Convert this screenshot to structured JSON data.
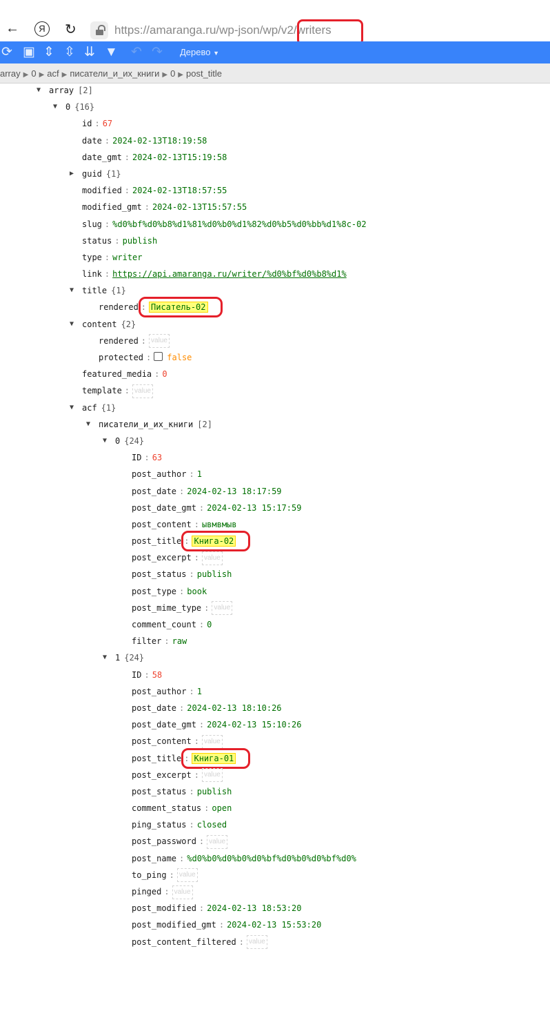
{
  "browser": {
    "url": "https://amaranga.ru/wp-json/wp/v2/writers",
    "back_icon": "arrow-left",
    "yandex_icon": "Я",
    "reload_icon": "reload",
    "lock_icon": "lock-open"
  },
  "toolbar": {
    "mode_label": "Дерево",
    "accent": "#3883fa"
  },
  "breadcrumb": [
    "array",
    "0",
    "acf",
    "писатели_и_их_книги",
    "0",
    "post_title"
  ],
  "tree": {
    "key": "array",
    "count": "[2]",
    "expanded": true,
    "children": [
      {
        "key": "0",
        "count": "{16}",
        "expanded": true,
        "children": [
          {
            "key": "id",
            "type": "number",
            "value": "67"
          },
          {
            "key": "date",
            "type": "string",
            "value": "2024-02-13T18:19:58"
          },
          {
            "key": "date_gmt",
            "type": "string",
            "value": "2024-02-13T15:19:58"
          },
          {
            "key": "guid",
            "count": "{1}",
            "expanded": false
          },
          {
            "key": "modified",
            "type": "string",
            "value": "2024-02-13T18:57:55"
          },
          {
            "key": "modified_gmt",
            "type": "string",
            "value": "2024-02-13T15:57:55"
          },
          {
            "key": "slug",
            "type": "string",
            "value": "%d0%bf%d0%b8%d1%81%d0%b0%d1%82%d0%b5%d0%bb%d1%8c-02"
          },
          {
            "key": "status",
            "type": "string",
            "value": "publish"
          },
          {
            "key": "type",
            "type": "string",
            "value": "writer"
          },
          {
            "key": "link",
            "type": "link",
            "value": "https://api.amaranga.ru/writer/%d0%bf%d0%b8%d1%"
          },
          {
            "key": "title",
            "count": "{1}",
            "expanded": true,
            "children": [
              {
                "key": "rendered",
                "type": "string",
                "value": "Писатель-02",
                "highlighted": true
              }
            ]
          },
          {
            "key": "content",
            "count": "{2}",
            "expanded": true,
            "children": [
              {
                "key": "rendered",
                "type": "empty",
                "value": "value"
              },
              {
                "key": "protected",
                "type": "bool",
                "value": "false"
              }
            ]
          },
          {
            "key": "featured_media",
            "type": "number",
            "value": "0"
          },
          {
            "key": "template",
            "type": "empty",
            "value": "value"
          },
          {
            "key": "acf",
            "count": "{1}",
            "expanded": true,
            "children": [
              {
                "key": "писатели_и_их_книги",
                "count": "[2]",
                "expanded": true,
                "children": [
                  {
                    "key": "0",
                    "count": "{24}",
                    "expanded": true,
                    "children": [
                      {
                        "key": "ID",
                        "type": "number",
                        "value": "63"
                      },
                      {
                        "key": "post_author",
                        "type": "string",
                        "value": "1"
                      },
                      {
                        "key": "post_date",
                        "type": "string",
                        "value": "2024-02-13 18:17:59"
                      },
                      {
                        "key": "post_date_gmt",
                        "type": "string",
                        "value": "2024-02-13 15:17:59"
                      },
                      {
                        "key": "post_content",
                        "type": "string",
                        "value": "ывмвмыв"
                      },
                      {
                        "key": "post_title",
                        "type": "string",
                        "value": "Книга-02",
                        "highlighted": true
                      },
                      {
                        "key": "post_excerpt",
                        "type": "empty",
                        "value": "value"
                      },
                      {
                        "key": "post_status",
                        "type": "string",
                        "value": "publish"
                      },
                      {
                        "key": "post_type",
                        "type": "string",
                        "value": "book"
                      },
                      {
                        "key": "post_mime_type",
                        "type": "empty",
                        "value": "value"
                      },
                      {
                        "key": "comment_count",
                        "type": "string",
                        "value": "0"
                      },
                      {
                        "key": "filter",
                        "type": "string",
                        "value": "raw"
                      }
                    ]
                  },
                  {
                    "key": "1",
                    "count": "{24}",
                    "expanded": true,
                    "children": [
                      {
                        "key": "ID",
                        "type": "number",
                        "value": "58"
                      },
                      {
                        "key": "post_author",
                        "type": "string",
                        "value": "1"
                      },
                      {
                        "key": "post_date",
                        "type": "string",
                        "value": "2024-02-13 18:10:26"
                      },
                      {
                        "key": "post_date_gmt",
                        "type": "string",
                        "value": "2024-02-13 15:10:26"
                      },
                      {
                        "key": "post_content",
                        "type": "empty",
                        "value": "value"
                      },
                      {
                        "key": "post_title",
                        "type": "string",
                        "value": "Книга-01",
                        "highlighted": true
                      },
                      {
                        "key": "post_excerpt",
                        "type": "empty",
                        "value": "value"
                      },
                      {
                        "key": "post_status",
                        "type": "string",
                        "value": "publish"
                      },
                      {
                        "key": "comment_status",
                        "type": "string",
                        "value": "open"
                      },
                      {
                        "key": "ping_status",
                        "type": "string",
                        "value": "closed"
                      },
                      {
                        "key": "post_password",
                        "type": "empty",
                        "value": "value"
                      },
                      {
                        "key": "post_name",
                        "type": "string",
                        "value": "%d0%b0%d0%b0%d0%bf%d0%b0%d0%bf%d0%"
                      },
                      {
                        "key": "to_ping",
                        "type": "empty",
                        "value": "value"
                      },
                      {
                        "key": "pinged",
                        "type": "empty",
                        "value": "value"
                      },
                      {
                        "key": "post_modified",
                        "type": "string",
                        "value": "2024-02-13 18:53:20"
                      },
                      {
                        "key": "post_modified_gmt",
                        "type": "string",
                        "value": "2024-02-13 15:53:20"
                      },
                      {
                        "key": "post_content_filtered",
                        "type": "empty",
                        "value": "value"
                      }
                    ]
                  }
                ]
              }
            ]
          }
        ]
      }
    ]
  }
}
